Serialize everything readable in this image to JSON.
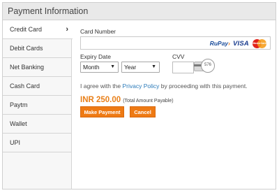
{
  "header": {
    "title": "Payment Information"
  },
  "sidebar": {
    "items": [
      {
        "label": "Credit Card",
        "active": true,
        "chevron": "›"
      },
      {
        "label": "Debit Cards"
      },
      {
        "label": "Net Banking"
      },
      {
        "label": "Cash Card"
      },
      {
        "label": "Paytm"
      },
      {
        "label": "Wallet"
      },
      {
        "label": "UPI"
      }
    ]
  },
  "form": {
    "card_number_label": "Card Number",
    "card_number_value": "",
    "logos": {
      "rupay_ru": "RuPay",
      "rupay_arrow": "›",
      "visa": "VISA",
      "mastercard": "MasterCard"
    },
    "expiry_label": "Expiry Date",
    "month_value": "Month",
    "year_value": "Year",
    "cvv_label": "CVV",
    "cvv_value": "",
    "cvv_hint": "576",
    "agree_prefix": "I agree with the ",
    "agree_link": "Privacy Policy",
    "agree_suffix": " by proceeding with this payment.",
    "amount": "INR 250.00",
    "amount_note": "(Total Amount Payable)",
    "make_payment_label": "Make Payment",
    "cancel_label": "Cancel"
  },
  "colors": {
    "accent": "#ee7a14",
    "link": "#2a7ab9",
    "header_bg": "#e9e9e9",
    "sidebar_bg": "#f7f7f7"
  }
}
